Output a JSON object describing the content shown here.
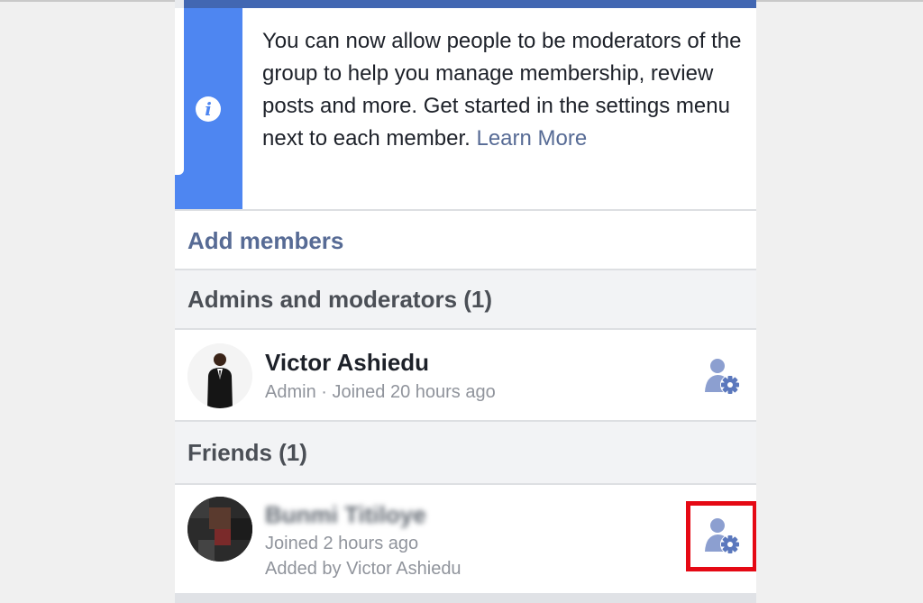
{
  "notice": {
    "text": "You can now allow people to be moderators of the group to help you manage membership, review posts and more. Get started in the settings menu next to each member.",
    "link": "Learn More",
    "icon": "info-icon"
  },
  "add_members": {
    "label": "Add members"
  },
  "sections": {
    "admins": {
      "title": "Admins and moderators (1)",
      "members": [
        {
          "name": "Victor Ashiedu",
          "meta": "Admin · Joined 20 hours ago",
          "settings_icon": "member-settings-icon"
        }
      ]
    },
    "friends": {
      "title": "Friends (1)",
      "members": [
        {
          "name": "Bunmi Titiloye",
          "meta": "Joined 2 hours ago",
          "added_by": "Added by Victor Ashiedu",
          "settings_icon": "member-settings-icon"
        }
      ]
    }
  },
  "colors": {
    "accent_blue": "#4267b2",
    "info_stripe": "#4e86f1",
    "link": "#576b95",
    "highlight": "#e50914"
  }
}
